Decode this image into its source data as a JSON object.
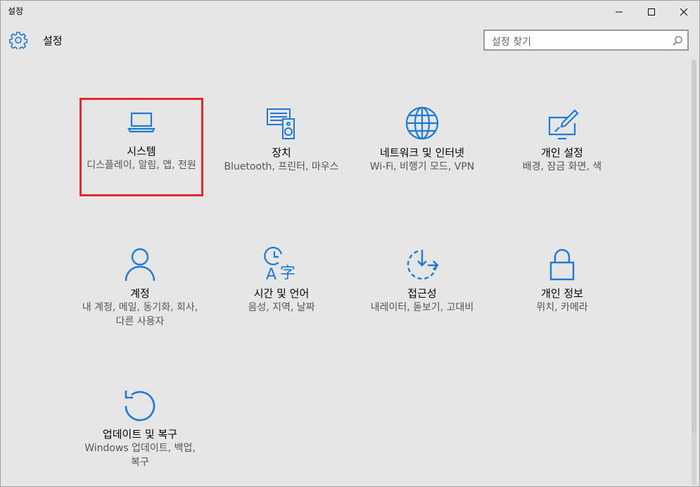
{
  "window": {
    "title": "설정"
  },
  "header": {
    "title": "설정",
    "search_placeholder": "설정 찾기"
  },
  "tiles": [
    {
      "name": "시스템",
      "desc": "디스플레이, 알림, 앱, 전원",
      "icon": "laptop-icon"
    },
    {
      "name": "장치",
      "desc": "Bluetooth, 프린터, 마우스",
      "icon": "devices-icon"
    },
    {
      "name": "네트워크 및 인터넷",
      "desc": "Wi-Fi, 비행기 모드, VPN",
      "icon": "globe-icon"
    },
    {
      "name": "개인 설정",
      "desc": "배경, 잠금 화면, 색",
      "icon": "paint-icon"
    },
    {
      "name": "계정",
      "desc": "내 계정, 메일, 동기화, 회사, 다른 사용자",
      "icon": "person-icon"
    },
    {
      "name": "시간 및 언어",
      "desc": "음성, 지역, 날짜",
      "icon": "time-language-icon"
    },
    {
      "name": "접근성",
      "desc": "내레이터, 돋보기, 고대비",
      "icon": "ease-of-access-icon"
    },
    {
      "name": "개인 정보",
      "desc": "위치, 카메라",
      "icon": "lock-icon"
    },
    {
      "name": "업데이트 및 복구",
      "desc": "Windows 업데이트, 백업, 복구",
      "icon": "refresh-icon"
    }
  ],
  "colors": {
    "accent": "#1e7ad4",
    "selection": "#e8262b"
  }
}
